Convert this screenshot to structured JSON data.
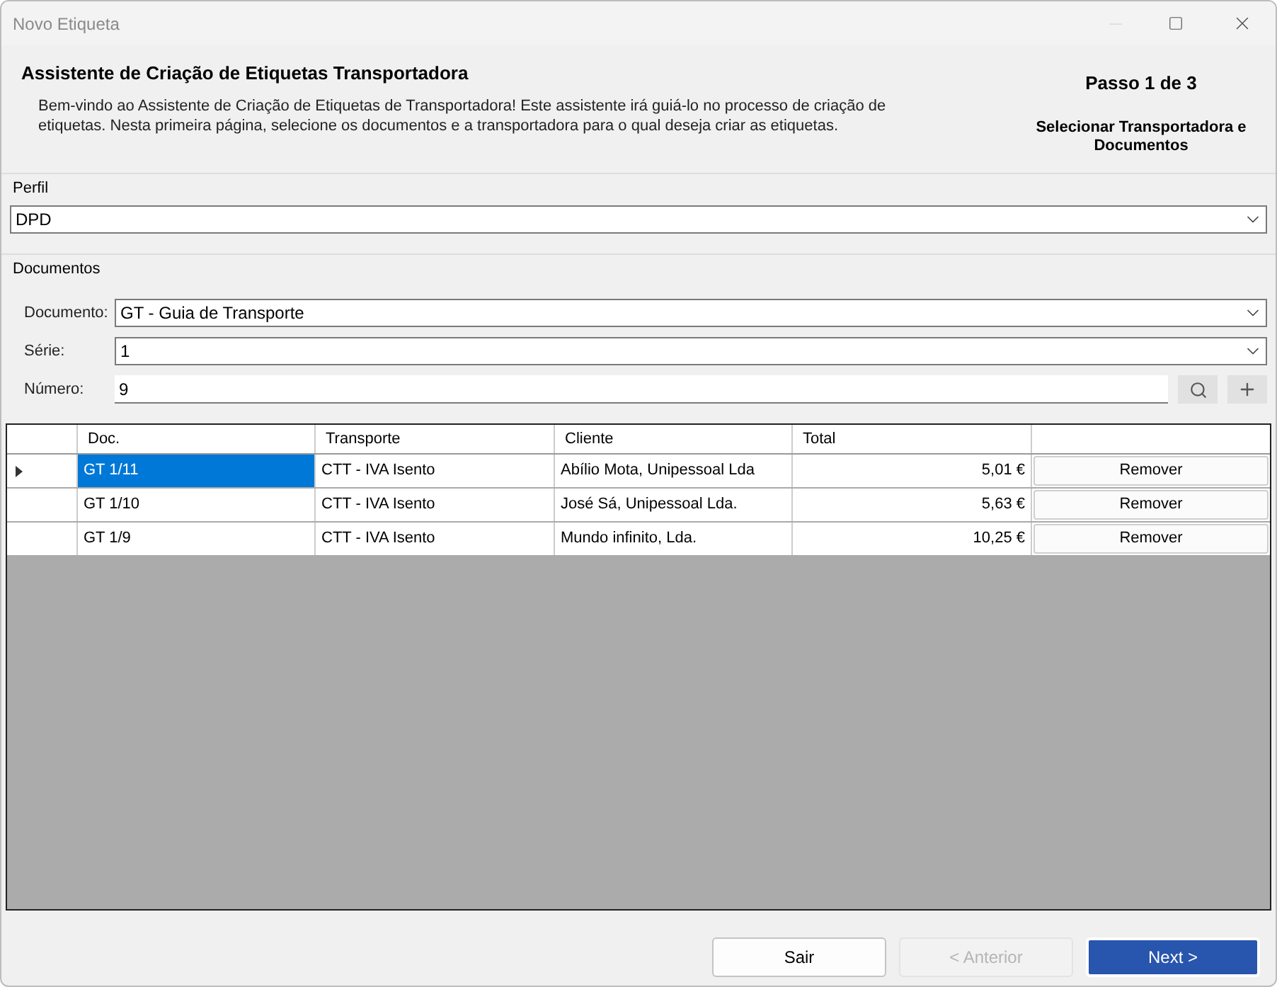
{
  "window": {
    "title": "Novo Etiqueta"
  },
  "header": {
    "title": "Assistente de Criação de Etiquetas Transportadora",
    "description": "Bem-vindo ao Assistente de Criação de Etiquetas de Transportadora! Este assistente irá guiá-lo no processo de criação de etiquetas. Nesta primeira página, selecione os documentos e a transportadora para o qual deseja criar as etiquetas.",
    "step": "Passo 1 de 3",
    "step_title": "Selecionar Transportadora e Documentos"
  },
  "perfil": {
    "label": "Perfil",
    "value": "DPD"
  },
  "documentos": {
    "label": "Documentos",
    "fields": [
      {
        "kind": "combo",
        "label": "Documento:",
        "value": "GT - Guia de Transporte"
      },
      {
        "kind": "combo",
        "label": "Série:",
        "value": "1"
      },
      {
        "kind": "text",
        "label": "Número:",
        "value": "9"
      }
    ]
  },
  "table": {
    "columns": [
      "Doc.",
      "Transporte",
      "Cliente",
      "Total"
    ],
    "rows": [
      {
        "selected": true,
        "cells": [
          "GT 1/11",
          "CTT - IVA Isento",
          "Abílio Mota, Unipessoal Lda",
          "5,01 €"
        ],
        "action": "Remover"
      },
      {
        "selected": false,
        "cells": [
          "GT 1/10",
          "CTT - IVA Isento",
          "José Sá, Unipessoal Lda.",
          "5,63 €"
        ],
        "action": "Remover"
      },
      {
        "selected": false,
        "cells": [
          "GT 1/9",
          "CTT - IVA Isento",
          "Mundo infinito, Lda.",
          "10,25 €"
        ],
        "action": "Remover"
      }
    ]
  },
  "buttons": [
    {
      "label": "Sair",
      "kind": "normal",
      "disabled": false
    },
    {
      "label": "< Anterior",
      "kind": "normal",
      "disabled": true
    },
    {
      "label": "Next >",
      "kind": "primary",
      "disabled": false
    }
  ]
}
